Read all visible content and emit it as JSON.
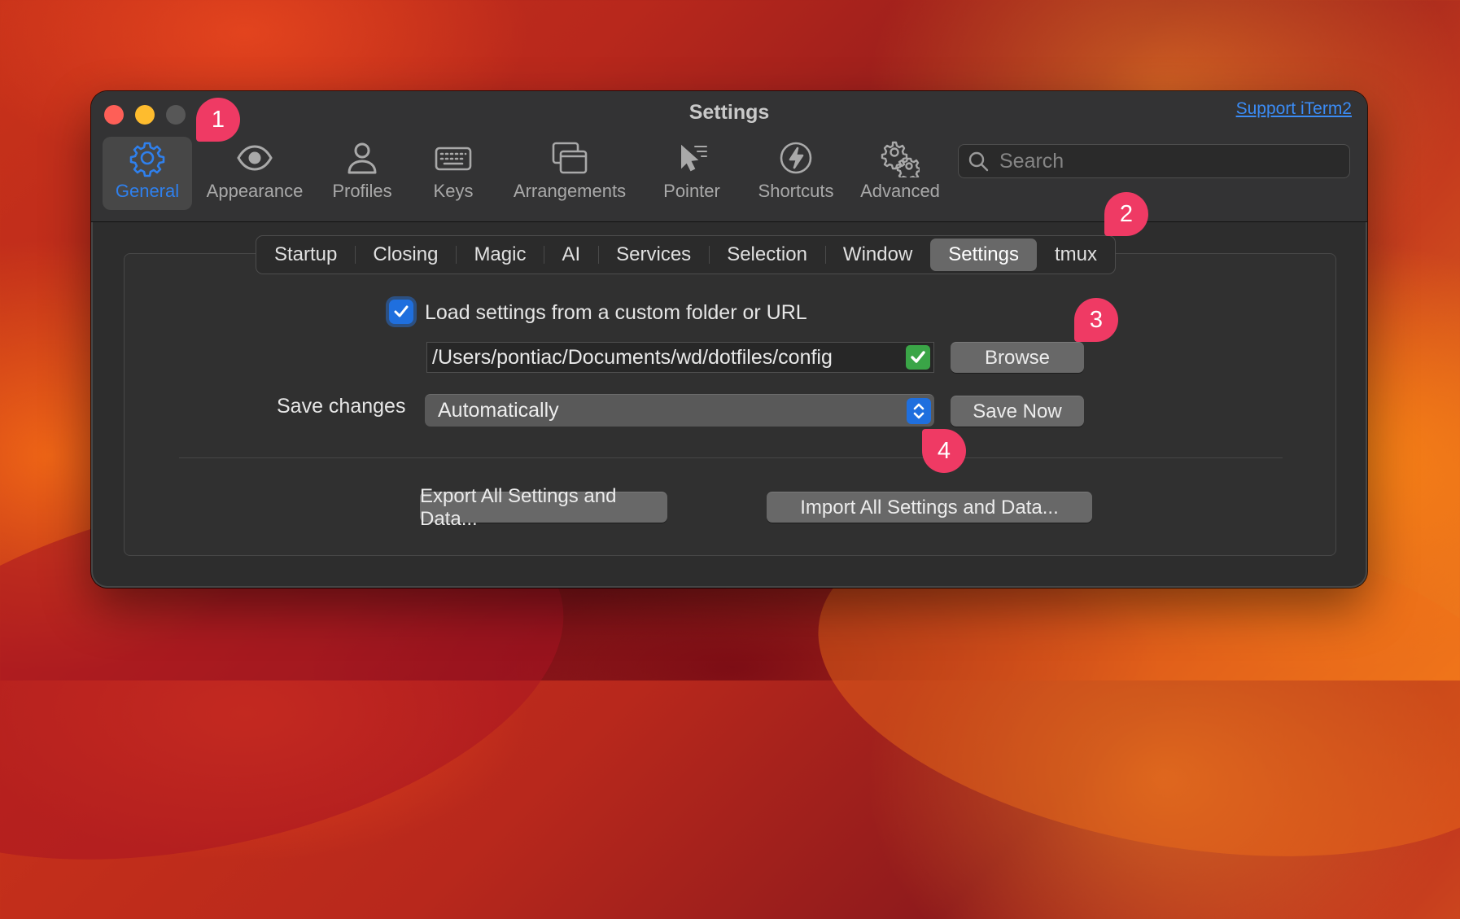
{
  "window": {
    "title": "Settings",
    "support_link": "Support iTerm2"
  },
  "toolbar": {
    "tabs": [
      {
        "label": "General",
        "icon": "gear-icon",
        "selected": true
      },
      {
        "label": "Appearance",
        "icon": "eye-icon",
        "selected": false
      },
      {
        "label": "Profiles",
        "icon": "person-icon",
        "selected": false
      },
      {
        "label": "Keys",
        "icon": "keyboard-icon",
        "selected": false
      },
      {
        "label": "Arrangements",
        "icon": "windows-icon",
        "selected": false
      },
      {
        "label": "Pointer",
        "icon": "pointer-icon",
        "selected": false
      },
      {
        "label": "Shortcuts",
        "icon": "bolt-icon",
        "selected": false
      },
      {
        "label": "Advanced",
        "icon": "gears-icon",
        "selected": false
      }
    ],
    "search": {
      "placeholder": "Search",
      "value": ""
    }
  },
  "subtabs": {
    "items": [
      "Startup",
      "Closing",
      "Magic",
      "AI",
      "Services",
      "Selection",
      "Window",
      "Settings",
      "tmux"
    ],
    "active": "Settings"
  },
  "settings": {
    "load_custom": {
      "checked": true,
      "label": "Load settings from a custom folder or URL"
    },
    "folder_path": "/Users/pontiac/Documents/wd/dotfiles/config",
    "browse_label": "Browse",
    "save_changes_label": "Save changes",
    "save_changes_value": "Automatically",
    "save_now_label": "Save Now",
    "export_label": "Export All Settings and Data...",
    "import_label": "Import All Settings and Data..."
  },
  "annotations": {
    "badge1": "1",
    "badge2": "2",
    "badge3": "3",
    "badge4": "4"
  },
  "colors": {
    "accent": "#2f80ed",
    "badge": "#ef3a64",
    "window_bg": "#2d2d2d",
    "toolbar_bg": "#333334"
  }
}
